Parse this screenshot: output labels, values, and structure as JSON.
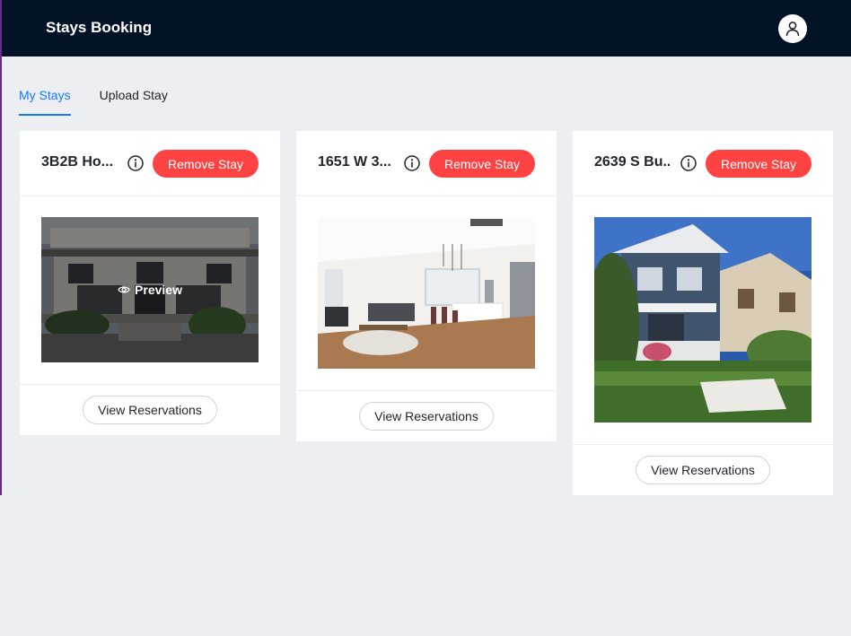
{
  "app": {
    "title": "Stays Booking",
    "user_icon": "user-icon"
  },
  "tabs": [
    {
      "label": "My Stays",
      "active": true
    },
    {
      "label": "Upload Stay",
      "active": false
    }
  ],
  "stays": [
    {
      "title": "3B2B Ho...",
      "remove_label": "Remove Stay",
      "view_label": "View Reservations",
      "preview_label": "Preview",
      "image": "house-exterior-photo"
    },
    {
      "title": "1651 W 3...",
      "remove_label": "Remove Stay",
      "view_label": "View Reservations",
      "image": "living-room-photo"
    },
    {
      "title": "2639 S Bu...",
      "remove_label": "Remove Stay",
      "view_label": "View Reservations",
      "image": "craftsman-house-photo"
    }
  ],
  "colors": {
    "header": "#021328",
    "accent": "#1677ff",
    "danger": "#ff4242",
    "background": "#eceef2"
  }
}
